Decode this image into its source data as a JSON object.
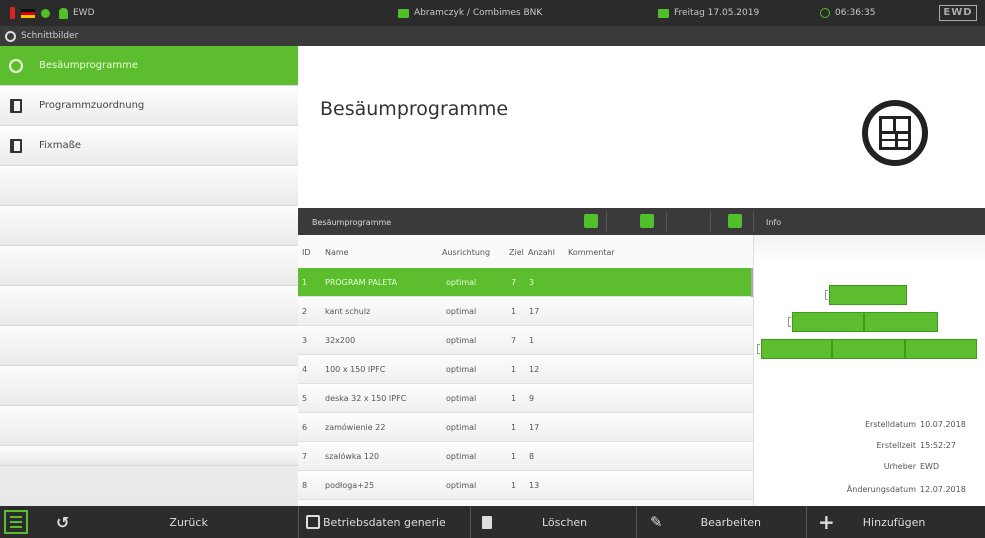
{
  "topbar": {
    "user": "EWD",
    "connection": "Abramczyk / Combimes BNK",
    "date": "Freitag 17.05.2019",
    "time": "06:36:35",
    "logo_text": "EWD",
    "accent": "#5cbd2e"
  },
  "subbar": {
    "title": "Schnittbilder"
  },
  "sidebar": {
    "items": [
      {
        "label": "Besäumprogramme",
        "icon": "globe-icon"
      },
      {
        "label": "Programmzuordnung",
        "icon": "book-icon"
      },
      {
        "label": "Fixmaße",
        "icon": "book-icon"
      }
    ]
  },
  "main": {
    "title": "Besäumprogramme",
    "table_title": "Besäumprogramme",
    "info_title": "Info"
  },
  "table": {
    "columns": [
      "ID",
      "Name",
      "Ausrichtung",
      "Ziel",
      "Anzahl",
      "Kommentar"
    ],
    "rows": [
      {
        "id": "1",
        "name": "PROGRAM PALETA",
        "ausrichtung": "optimal",
        "ziel": "7",
        "anzahl": "3"
      },
      {
        "id": "2",
        "name": "kant schulz",
        "ausrichtung": "optimal",
        "ziel": "1",
        "anzahl": "17"
      },
      {
        "id": "3",
        "name": "32x200",
        "ausrichtung": "optimal",
        "ziel": "7",
        "anzahl": "1"
      },
      {
        "id": "4",
        "name": "100 x 150 IPFC",
        "ausrichtung": "optimal",
        "ziel": "1",
        "anzahl": "12"
      },
      {
        "id": "5",
        "name": "deska 32 x 150 IPFC",
        "ausrichtung": "optimal",
        "ziel": "1",
        "anzahl": "9"
      },
      {
        "id": "6",
        "name": "zamówienie 22",
        "ausrichtung": "optimal",
        "ziel": "1",
        "anzahl": "17"
      },
      {
        "id": "7",
        "name": "szalówka 120",
        "ausrichtung": "optimal",
        "ziel": "1",
        "anzahl": "8"
      },
      {
        "id": "8",
        "name": "podłoga+25",
        "ausrichtung": "optimal",
        "ziel": "1",
        "anzahl": "13"
      }
    ]
  },
  "info": {
    "erstelldatum_label": "Erstelldatum",
    "erstelldatum": "10.07.2018",
    "erstellzeit_label": "Erstellzeit",
    "erstellzeit": "15:52:27",
    "urheber_label": "Urheber",
    "urheber": "EWD",
    "aenderungsdatum_label": "Änderungsdatum",
    "aenderungsdatum": "12.07.2018"
  },
  "bottombar": {
    "back": "Zurück",
    "betriebsdaten": "Betriebsdaten generie",
    "delete": "Löschen",
    "edit": "Bearbeiten",
    "add": "Hinzufügen"
  }
}
